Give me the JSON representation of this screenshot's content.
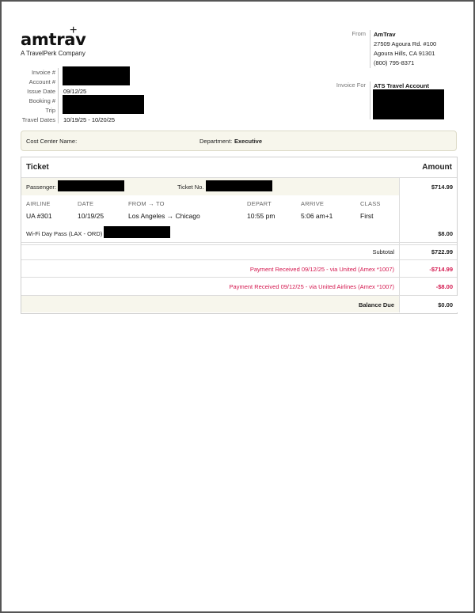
{
  "logo": {
    "word": "amtrav",
    "plus": "+",
    "sub": "A TravelPerk Company"
  },
  "meta": [
    {
      "label": "Invoice #",
      "value": ""
    },
    {
      "label": "Account #",
      "value": ""
    },
    {
      "label": "Issue Date",
      "value": "09/12/25"
    },
    {
      "label": "Booking #",
      "value": ""
    },
    {
      "label": "Trip",
      "value": ""
    },
    {
      "label": "Travel Dates",
      "value": "10/19/25 - 10/20/25"
    }
  ],
  "from": {
    "label": "From",
    "name": "AmTrav",
    "lines": [
      "27509 Agoura Rd. #100",
      "Agoura Hills, CA 91301",
      "(800) 795-8371"
    ]
  },
  "invoice_for": {
    "label": "Invoice For",
    "name": "ATS Travel Account"
  },
  "cost_center": {
    "label": "Cost Center Name:",
    "dept_label": "Department:",
    "dept_value": "Executive"
  },
  "ticket": {
    "header_left": "Ticket",
    "header_right": "Amount",
    "passenger_label": "Passenger:",
    "ticket_no_label": "Ticket No.",
    "ticket_amount": "$714.99",
    "flight_headers": [
      "AIRLINE",
      "DATE",
      "FROM → TO",
      "DEPART",
      "ARRIVE",
      "CLASS"
    ],
    "flight_values": [
      "UA #301",
      "10/19/25",
      "Los Angeles → Chicago",
      "10:55 pm",
      "5:06 am+1",
      "First"
    ],
    "wifi_label": "Wi-Fi Day Pass (LAX - ORD)",
    "wifi_amount": "$8.00",
    "subtotal_label": "Subtotal",
    "subtotal_amount": "$722.99",
    "payment1_label": "Payment Received 09/12/25 - via United (Amex *1007)",
    "payment1_amount": "-$714.99",
    "payment2_label": "Payment Received 09/12/25 - via United Airlines (Amex *1007)",
    "payment2_amount": "-$8.00",
    "balance_label": "Balance Due",
    "balance_amount": "$0.00"
  },
  "colors": {
    "accent_pink": "#d4184f",
    "panel_bg": "#f7f6ec"
  }
}
